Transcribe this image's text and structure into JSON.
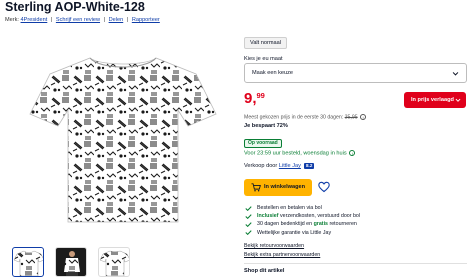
{
  "product": {
    "title": "Sterling AOP-White-128",
    "brand_prefix": "Merk:",
    "brand": "4President",
    "write_review": "Schrijf een review",
    "share": "Delen",
    "report": "Rapporteer",
    "separator": "|"
  },
  "size": {
    "chip": "Valt normaal",
    "label": "Kies je eu maat",
    "select_value": "Maak een keuze"
  },
  "price": {
    "euros": "9,",
    "cents": "99",
    "button_label": "In prijs verlaagd",
    "low_price_text": "Meest gekozen prijs in de eerste 30 dagen:",
    "old_price": "35,95",
    "saving": "Je bespaart 72%"
  },
  "stock": {
    "badge": "Op voorraad",
    "delivery": "Voor 23:59 uur besteld, woensdag in huis"
  },
  "seller": {
    "prefix": "Verkoop door",
    "name": "Little Jay",
    "score": "8.2"
  },
  "cart": {
    "label": "In winkelwagen"
  },
  "usps": [
    {
      "pre": "",
      "bold": "",
      "post": "Bestellen en betalen via bol"
    },
    {
      "pre": "",
      "bold": "Inclusief",
      "post": " verzendkosten, verstuurd door bol"
    },
    {
      "pre": "30 dagen bedenktijd en ",
      "bold": "gratis",
      "post": " retourneren"
    },
    {
      "pre": "",
      "bold": "",
      "post": "Wettelijke garantie via Little Jay"
    }
  ],
  "links": {
    "return_terms": "Bekijk retourvoorwaarden",
    "partner_terms": "Bekijk extra partnervoorwaarden",
    "shop_section": "Shop dit artikel"
  },
  "colors": {
    "brand_blue": "#0f3da8",
    "price_red": "#e0001b",
    "stock_green": "#0a7e35",
    "cart_yellow": "#ffb300"
  }
}
